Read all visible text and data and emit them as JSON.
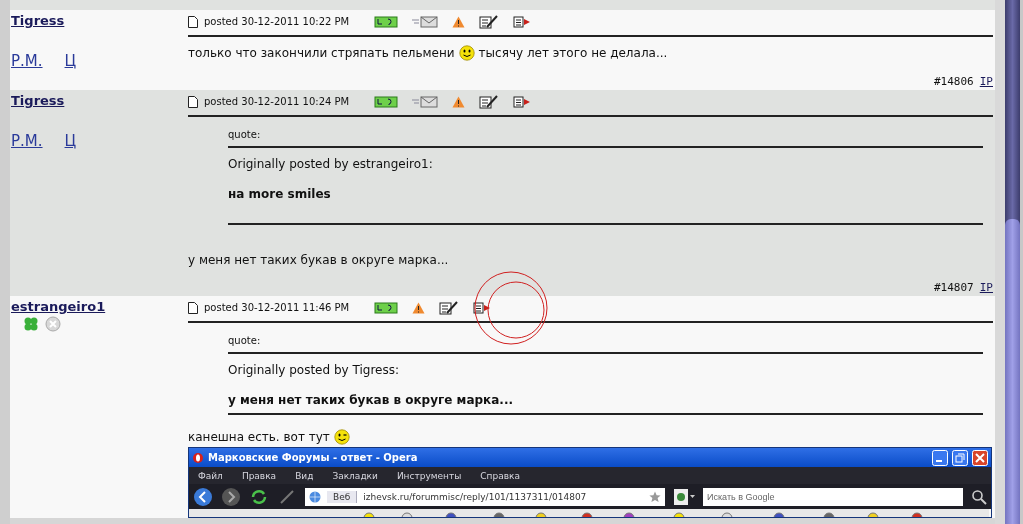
{
  "posts": [
    {
      "author": "Tigress",
      "shaded": false,
      "links": [
        "Р.М.",
        "Ц"
      ],
      "posted": "posted 30-12-2011 10:22 PM",
      "email_icon": true,
      "message": [
        {
          "kind": "text",
          "text": "только что закончили стряпать пельмени"
        },
        {
          "kind": "smiley"
        },
        {
          "kind": "text",
          "text": "тысячу лет этого не делала..."
        }
      ],
      "number": "#14806",
      "ip": "IP"
    },
    {
      "author": "Tigress",
      "shaded": true,
      "links": [
        "Р.М.",
        "Ц"
      ],
      "posted": "posted 30-12-2011 10:24 PM",
      "email_icon": true,
      "quote": {
        "label": "quote:",
        "attribution": "Originally posted by estrangeiro1:",
        "text": "на more smiles"
      },
      "message": [
        {
          "kind": "text",
          "text": "у меня нет таких букав в округе марка..."
        }
      ],
      "number": "#14807",
      "ip": "IP"
    },
    {
      "author": "estrangeiro1",
      "shaded": false,
      "status_icons": true,
      "posted": "posted 30-12-2011 11:46 PM",
      "email_icon": false,
      "highlighted": true,
      "quote": {
        "label": "quote:",
        "attribution": "Originally posted by Tigress:",
        "text": "у меня нет таких букав в округе марка..."
      },
      "message": [
        {
          "kind": "text",
          "text": "канешна есть. вот тут"
        },
        {
          "kind": "wink"
        }
      ],
      "screenshot": {
        "title": "Марковские Форумы - ответ - Opera",
        "menu": [
          "Файл",
          "Правка",
          "Вид",
          "Закладки",
          "Инструменты",
          "Справка"
        ],
        "address_label": "Веб",
        "url": "izhevsk.ru/forummisc/reply/101/1137311/014807",
        "search_placeholder": "Искать в Google"
      }
    }
  ]
}
